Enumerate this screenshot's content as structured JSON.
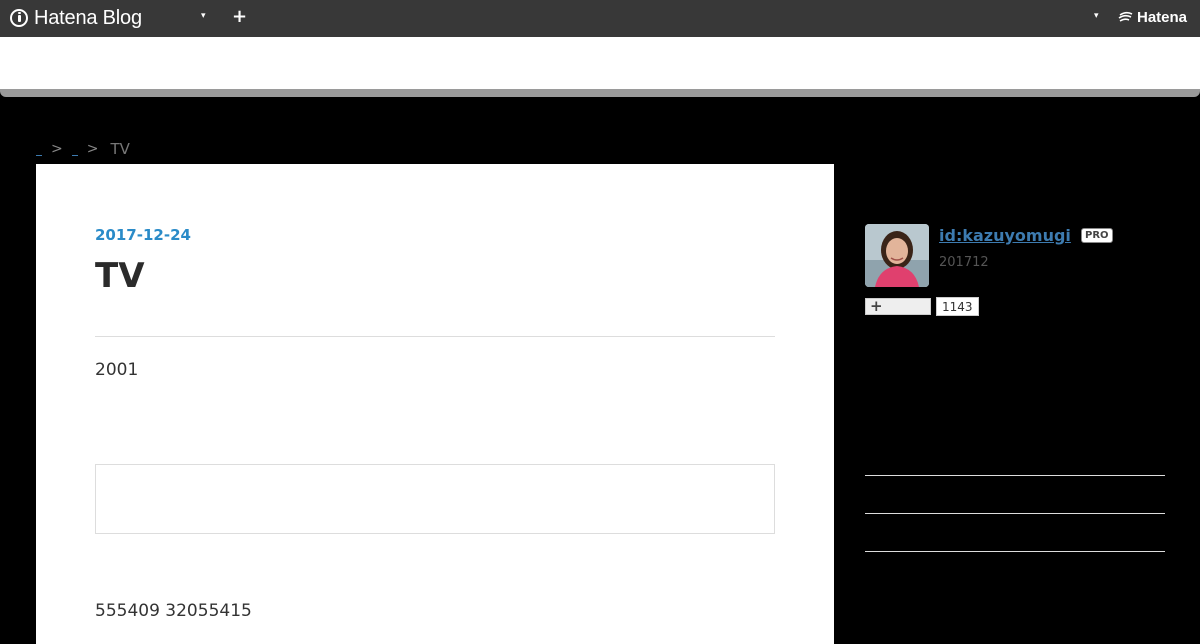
{
  "topbar": {
    "brand": "Hatena Blog",
    "hatena_label": "Hatena",
    "caret": "▾",
    "plus": "+"
  },
  "breadcrumb": {
    "separator": ">",
    "current": "TV"
  },
  "article": {
    "date": "2017-12-24",
    "title": "TV",
    "paragraph1": "2001",
    "paragraph2": "555409 32055415"
  },
  "sidebar": {
    "user_id": "id:kazuyomugi",
    "badge": "PRO",
    "since": "201712",
    "follow_symbol": "+",
    "follower_count": "1143"
  },
  "colors": {
    "topbar": "#383838",
    "accent": "#2a8bc8",
    "link": "#3d7bb0",
    "page_bg": "#000000"
  }
}
